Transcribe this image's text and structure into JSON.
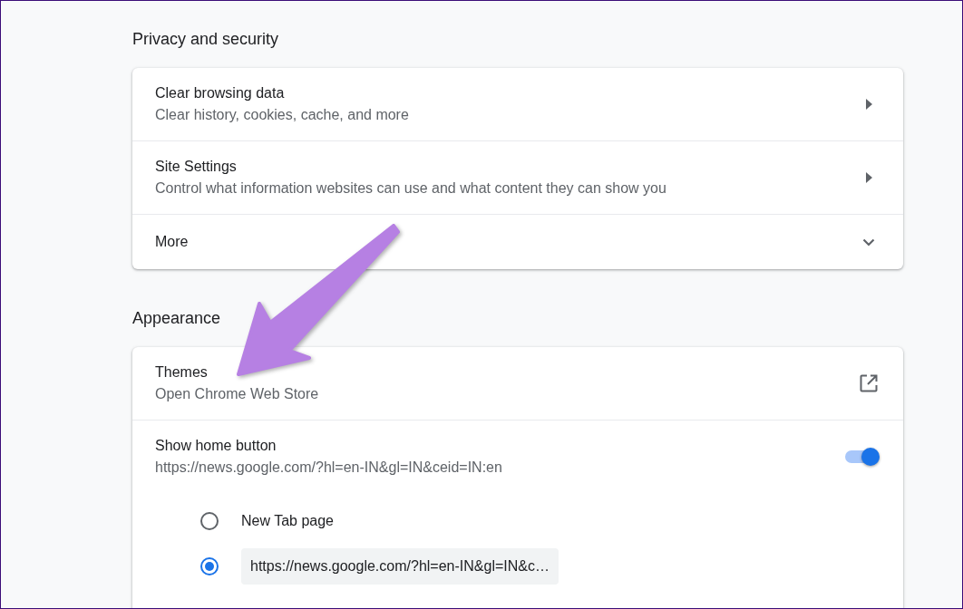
{
  "sections": [
    {
      "title": "Privacy and security",
      "rows": [
        {
          "kind": "link",
          "title": "Clear browsing data",
          "subtitle": "Clear history, cookies, cache, and more"
        },
        {
          "kind": "link",
          "title": "Site Settings",
          "subtitle": "Control what information websites can use and what content they can show you"
        },
        {
          "kind": "expand",
          "title": "More",
          "expanded": false
        }
      ]
    },
    {
      "title": "Appearance",
      "rows": [
        {
          "kind": "external",
          "title": "Themes",
          "subtitle": "Open Chrome Web Store"
        },
        {
          "kind": "toggle",
          "title": "Show home button",
          "subtitle": "https://news.google.com/?hl=en-IN&gl=IN&ceid=IN:en",
          "on": true,
          "options": [
            {
              "kind": "label",
              "label": "New Tab page",
              "selected": false
            },
            {
              "kind": "input",
              "value": "https://news.google.com/?hl=en-IN&gl=IN&c…",
              "selected": true
            }
          ]
        }
      ]
    }
  ]
}
